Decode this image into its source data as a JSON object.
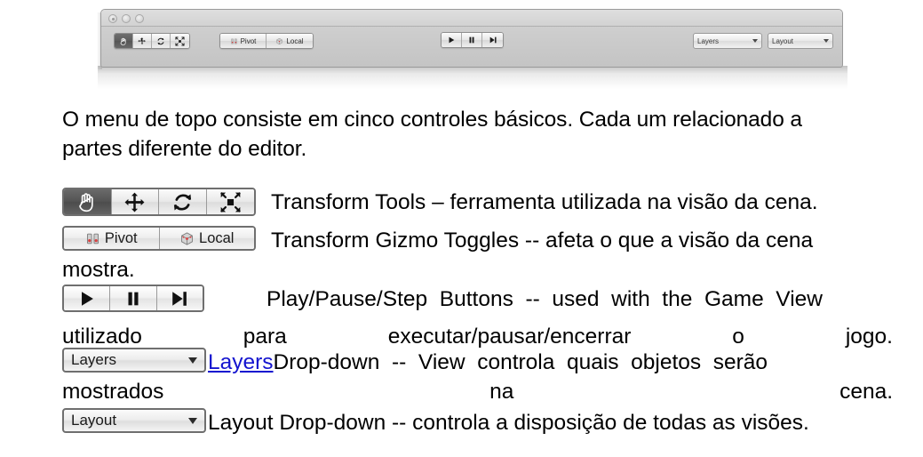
{
  "window": {
    "traffic_lights": [
      "close-button",
      "minimize-button",
      "zoom-button"
    ],
    "toolbar": {
      "transform_tools": [
        {
          "name": "hand-tool",
          "selected": true
        },
        {
          "name": "move-tool",
          "selected": false
        },
        {
          "name": "rotate-tool",
          "selected": false
        },
        {
          "name": "scale-tool",
          "selected": false
        }
      ],
      "gizmo_toggles": [
        {
          "name": "pivot-toggle",
          "label": "Pivot"
        },
        {
          "name": "local-toggle",
          "label": "Local"
        }
      ],
      "playback": [
        {
          "name": "play-button"
        },
        {
          "name": "pause-button"
        },
        {
          "name": "step-button"
        }
      ],
      "layers_dropdown": "Layers",
      "layout_dropdown": "Layout"
    }
  },
  "intro": {
    "line1": "O menu de topo consiste em cinco controles básicos. Cada um relacionado a",
    "line2": "partes diferente do editor."
  },
  "figures": {
    "transform_tools": {
      "buttons": [
        {
          "label": "",
          "icon": "hand-icon",
          "selected": true
        },
        {
          "label": "",
          "icon": "move-arrows-icon",
          "selected": false
        },
        {
          "label": "",
          "icon": "rotate-icon",
          "selected": false
        },
        {
          "label": "",
          "icon": "scale-icon",
          "selected": false
        }
      ],
      "description": "Transform Tools – ferramenta utilizada na visão da cena."
    },
    "gizmo_toggles": {
      "pivot_label": "Pivot",
      "local_label": "Local",
      "description": "Transform Gizmo Toggles -- afeta o que a visão da cena",
      "continuation": "mostra."
    },
    "play_buttons": {
      "description": "Play/Pause/Step  Buttons  --  used  with  the  Game  View",
      "justified_words": [
        "utilizado",
        "para",
        "executar/pausar/encerrar",
        "o",
        "jogo."
      ]
    },
    "layers": {
      "dropdown_label": "Layers",
      "link_text": "Layers",
      "description": "Drop-down  --  View  controla  quais  objetos  serão",
      "justified_words": [
        "mostrados",
        "na",
        "cena."
      ]
    },
    "layout": {
      "dropdown_label": "Layout",
      "description": "Layout Drop-down -- controla a disposição de todas as visões."
    }
  },
  "colors": {
    "link": "#1414cf",
    "text": "#000000",
    "page_background": "#ffffff",
    "window_chrome": "#cfcfcf",
    "selected_tool": "#565656",
    "pivot_marker_red": "#d94040"
  }
}
